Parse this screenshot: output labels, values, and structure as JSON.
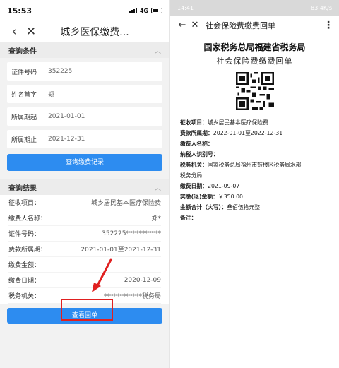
{
  "left": {
    "status": {
      "time": "15:53",
      "network": "4G"
    },
    "nav": {
      "back_icon": "‹",
      "close_icon": "✕",
      "title": "城乡医保缴费..."
    },
    "query_section": {
      "title": "查询条件",
      "chevron": "︿"
    },
    "form": [
      {
        "label": "证件号码",
        "value": "352225"
      },
      {
        "label": "姓名首字",
        "value": "郑"
      },
      {
        "label": "所属期起",
        "value": "2021-01-01"
      },
      {
        "label": "所属期止",
        "value": "2021-12-31"
      }
    ],
    "query_button": "查询缴费记录",
    "result_section": {
      "title": "查询结果",
      "chevron": "︿"
    },
    "results": [
      {
        "label": "征收项目：",
        "value": "城乡居民基本医疗保险费"
      },
      {
        "label": "缴费人名称：",
        "value": "郑*"
      },
      {
        "label": "证件号码：",
        "value": "352225***********"
      },
      {
        "label": "费款所属期：",
        "value": "2021-01-01至2021-12-31"
      },
      {
        "label": "缴费金额：",
        "value": ""
      },
      {
        "label": "缴费日期：",
        "value": "2020-12-09"
      },
      {
        "label": "税务机关：",
        "value": "************税务局"
      }
    ],
    "view_button": "查看回单"
  },
  "right": {
    "status": {
      "time": "14:41",
      "info": "83.4K/s"
    },
    "nav": {
      "back_icon": "←",
      "close_icon": "✕",
      "title": "社会保险费缴费回单",
      "more_icon": "⋮"
    },
    "doc_title": "国家税务总局福建省税务局",
    "doc_subtitle": "社会保险费缴费回单",
    "fields": [
      {
        "label": "征收项目：",
        "value": "城乡居民基本医疗保险费"
      },
      {
        "label": "费款所属期：",
        "value": "2022-01-01至2022-12-31"
      },
      {
        "label": "缴费人名称：",
        "value": ""
      },
      {
        "label": "纳税人识别号：",
        "value": ""
      },
      {
        "label": "税务机关：",
        "value": "国家税务总局福州市鼓楼区税务局水部"
      },
      {
        "label": "",
        "value": "税务分局"
      },
      {
        "label": "缴费日期：",
        "value": "2021-09-07"
      },
      {
        "label": "实缴(退)金额：",
        "value": "￥350.00"
      },
      {
        "label": "金额合计（大写）：",
        "value": "叁佰伍拾元整"
      },
      {
        "label": "备注：",
        "value": ""
      }
    ],
    "colors": {
      "accent": "#2d8cf0",
      "highlight": "#e02020"
    }
  }
}
